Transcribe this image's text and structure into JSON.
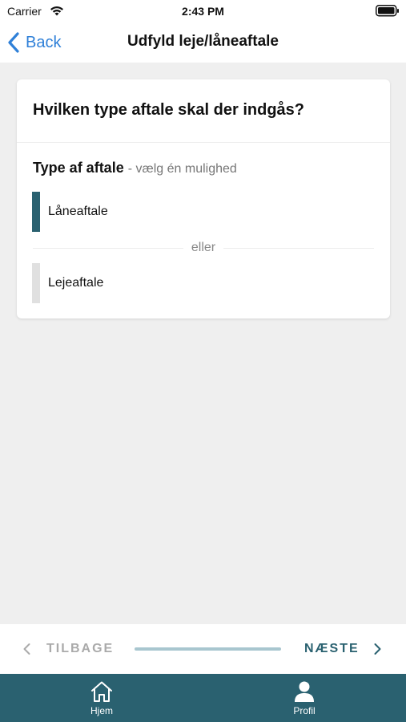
{
  "status_bar": {
    "carrier": "Carrier",
    "time": "2:43 PM"
  },
  "nav": {
    "back_label": "Back",
    "title": "Udfyld leje/låneaftale"
  },
  "card": {
    "title": "Hvilken type aftale skal der indgås?",
    "section_heading": "Type af aftale",
    "section_hint": "- vælg én mulighed",
    "options": [
      {
        "label": "Låneaftale",
        "selected": true
      },
      {
        "label": "Lejeaftale",
        "selected": false
      }
    ],
    "divider_text": "eller"
  },
  "stepper": {
    "prev_label": "TILBAGE",
    "next_label": "NÆSTE"
  },
  "tab_bar": {
    "tabs": [
      {
        "label": "Hjem",
        "icon": "home-icon"
      },
      {
        "label": "Profil",
        "icon": "profile-icon"
      }
    ]
  },
  "colors": {
    "accent": "#2a6170",
    "link": "#2f80d8",
    "background": "#efefef",
    "progress_track": "#a8c6cf"
  }
}
